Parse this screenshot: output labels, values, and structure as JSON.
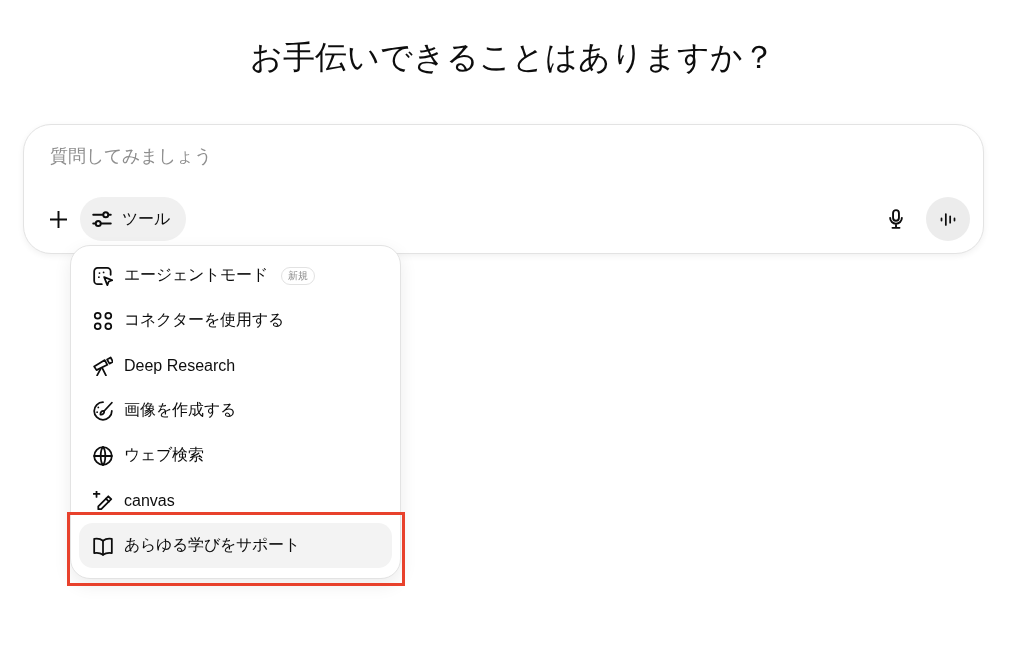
{
  "heading": "お手伝いできることはありますか？",
  "composer": {
    "placeholder": "質問してみましょう",
    "tools_button": {
      "label": "ツール",
      "expanded": true
    }
  },
  "tools_menu": {
    "items": [
      {
        "label": "エージェントモード",
        "badge": "新規",
        "selected": false,
        "annotated": false
      },
      {
        "label": "コネクターを使用する",
        "selected": false,
        "annotated": false
      },
      {
        "label": "Deep Research",
        "selected": false,
        "annotated": false
      },
      {
        "label": "画像を作成する",
        "selected": false,
        "annotated": false
      },
      {
        "label": "ウェブ検索",
        "selected": false,
        "annotated": false
      },
      {
        "label": "canvas",
        "selected": false,
        "annotated": false
      },
      {
        "label": "あらゆる学びをサポート",
        "selected": true,
        "annotated": true
      }
    ]
  }
}
